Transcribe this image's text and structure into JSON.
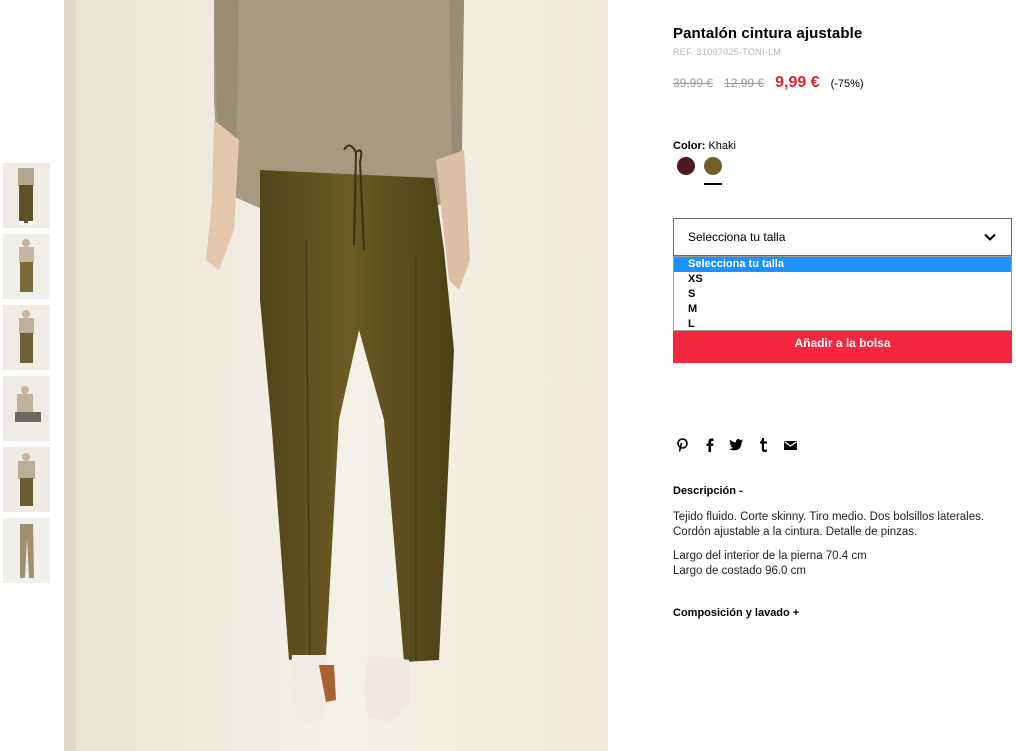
{
  "product": {
    "title": "Pantalón cintura ajustable",
    "ref": "REF. 31097025-TONI-LM",
    "price_original_1": "39,99 €",
    "price_original_2": "12,99 €",
    "price_current": "9,99 €",
    "discount": "(-75%)"
  },
  "color": {
    "label": "Color:",
    "value": "Khaki",
    "swatches": [
      {
        "name": "burgundy",
        "hex": "#4a1a22"
      },
      {
        "name": "khaki",
        "hex": "#6f5d2a",
        "selected": true
      }
    ]
  },
  "size": {
    "placeholder": "Selecciona tu talla",
    "options": [
      "Selecciona tu talla",
      "XS",
      "S",
      "M",
      "L"
    ],
    "highlighted": "Selecciona tu talla"
  },
  "add_to_bag": "Añadir a la bolsa",
  "share_icons": [
    "pinterest-icon",
    "facebook-icon",
    "twitter-icon",
    "tumblr-icon",
    "email-icon"
  ],
  "description": {
    "heading": "Descripción -",
    "line1": "Tejido fluido. Corte skinny. Tiro medio. Dos bolsillos laterales.",
    "line2": "Cordón ajustable a la cintura. Detalle de pinzas.",
    "line3": "Largo del interior de la pierna 70.4 cm",
    "line4": "Largo de costado 96.0 cm"
  },
  "composition_heading": "Composición y lavado +",
  "colors": {
    "accent_red": "#f3263d",
    "price_red": "#e2232d",
    "highlight_blue": "#1e90ff"
  }
}
